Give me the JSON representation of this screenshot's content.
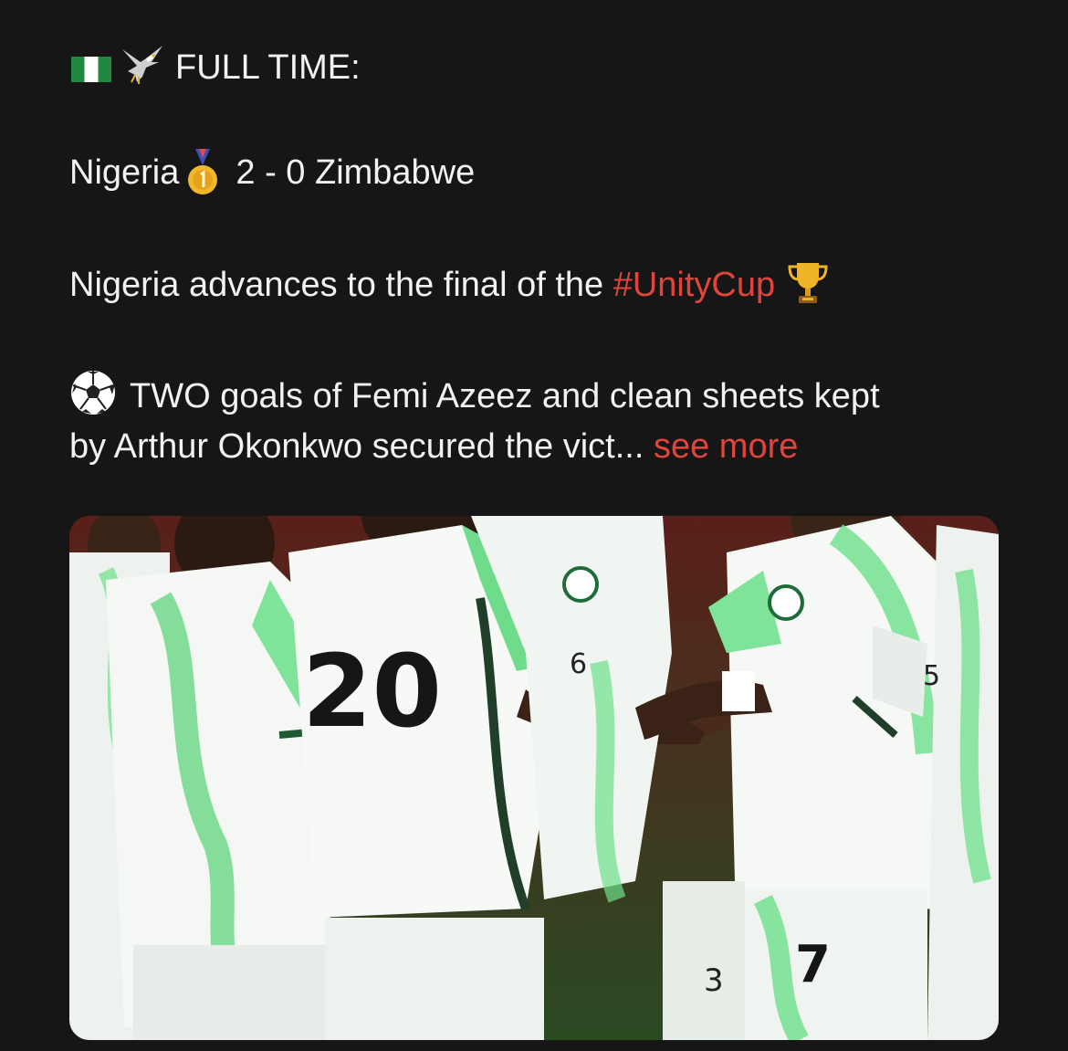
{
  "post": {
    "header": {
      "label": "FULL TIME:"
    },
    "score": {
      "home": "Nigeria",
      "result": "2 - 0 Zimbabwe"
    },
    "advance": {
      "text": "Nigeria advances to the final of the ",
      "hashtag": "#UnityCup"
    },
    "summary": {
      "line1": "TWO goals of Femi Azeez and clean sheets kept",
      "line2": "by Arthur Okonkwo secured the vict...",
      "see_more": "see more"
    },
    "icons": [
      "nigeria-flag-icon",
      "eagle-icon",
      "gold-medal-icon",
      "trophy-icon",
      "soccer-ball-icon"
    ],
    "photo": {
      "jersey_numbers": [
        "20",
        "6",
        "7",
        "5",
        "3",
        "7"
      ]
    }
  },
  "colors": {
    "background": "#161616",
    "text": "#f2f2f2",
    "accent": "#e0453c"
  }
}
